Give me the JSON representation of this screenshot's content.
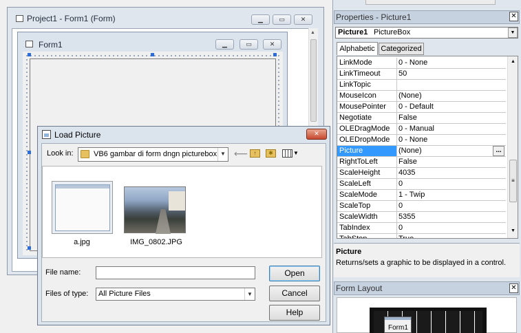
{
  "project_window": {
    "title": "Project1 - Form1 (Form)"
  },
  "form_window": {
    "title": "Form1"
  },
  "dialog": {
    "title": "Load Picture",
    "look_in_label": "Look in:",
    "look_in_value": "VB6 gambar di form dngn picturebox",
    "files": [
      {
        "name": "a.jpg",
        "thumb": "form-screenshot"
      },
      {
        "name": "IMG_0802.JPG",
        "thumb": "photo"
      }
    ],
    "file_name_label": "File name:",
    "file_name_value": "",
    "files_of_type_label": "Files of type:",
    "files_of_type_value": "All Picture Files",
    "open_label": "Open",
    "cancel_label": "Cancel",
    "help_label": "Help"
  },
  "properties": {
    "title": "Properties - Picture1",
    "object_name": "Picture1",
    "object_type": "PictureBox",
    "tabs": [
      "Alphabetic",
      "Categorized"
    ],
    "active_tab": "Alphabetic",
    "rows": [
      {
        "name": "LinkMode",
        "value": "0 - None"
      },
      {
        "name": "LinkTimeout",
        "value": "50"
      },
      {
        "name": "LinkTopic",
        "value": ""
      },
      {
        "name": "MouseIcon",
        "value": "(None)"
      },
      {
        "name": "MousePointer",
        "value": "0 - Default"
      },
      {
        "name": "Negotiate",
        "value": "False"
      },
      {
        "name": "OLEDragMode",
        "value": "0 - Manual"
      },
      {
        "name": "OLEDropMode",
        "value": "0 - None"
      },
      {
        "name": "Picture",
        "value": "(None)",
        "selected": true
      },
      {
        "name": "RightToLeft",
        "value": "False"
      },
      {
        "name": "ScaleHeight",
        "value": "4035"
      },
      {
        "name": "ScaleLeft",
        "value": "0"
      },
      {
        "name": "ScaleMode",
        "value": "1 - Twip"
      },
      {
        "name": "ScaleTop",
        "value": "0"
      },
      {
        "name": "ScaleWidth",
        "value": "5355"
      },
      {
        "name": "TabIndex",
        "value": "0"
      },
      {
        "name": "TabStop",
        "value": "True"
      }
    ],
    "desc_title": "Picture",
    "desc_text": "Returns/sets a graphic to be displayed in a control."
  },
  "form_layout": {
    "title": "Form Layout",
    "form_label": "Form1"
  },
  "colors": {
    "selection": "#3399ff",
    "close_red": "#c7472f"
  }
}
